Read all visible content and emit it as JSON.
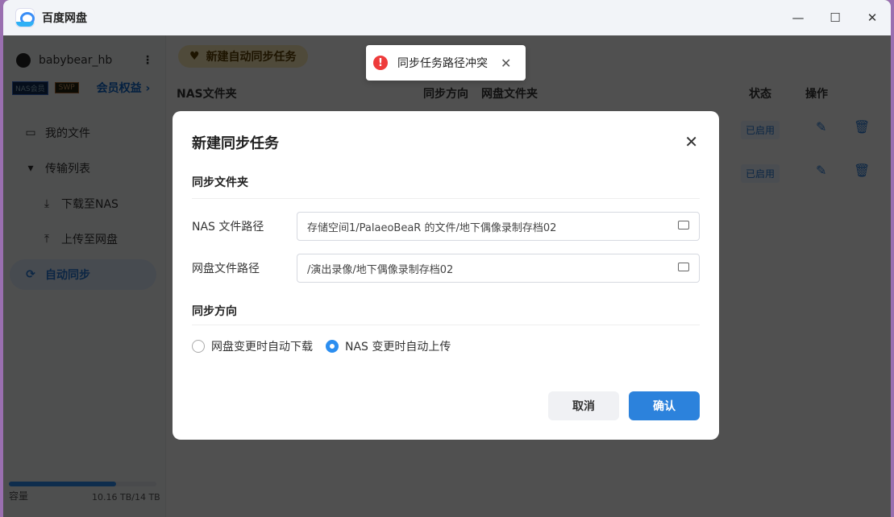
{
  "app": {
    "title": "百度网盘"
  },
  "sidebar": {
    "username": "babybear_hb",
    "badges": [
      "NAS会员",
      "SWP"
    ],
    "vip_link": "会员权益 ›",
    "items": [
      {
        "label": "我的文件",
        "icon": "folder-icon"
      },
      {
        "label": "传输列表",
        "icon": "caret-down-icon"
      },
      {
        "label": "下载至NAS",
        "icon": "download-icon"
      },
      {
        "label": "上传至网盘",
        "icon": "upload-icon"
      },
      {
        "label": "自动同步",
        "icon": "sync-icon",
        "active": true
      }
    ],
    "storage": {
      "label": "容量",
      "value": "10.16 TB/14 TB",
      "used_fraction": 0.726
    }
  },
  "main": {
    "new_button": "新建自动同步任务",
    "columns": [
      "NAS文件夹",
      "同步方向",
      "网盘文件夹",
      "状态",
      "操作"
    ],
    "rows": [
      {
        "status": "已启用"
      },
      {
        "status": "已启用"
      }
    ]
  },
  "toast": {
    "message": "同步任务路径冲突"
  },
  "modal": {
    "title": "新建同步任务",
    "section_folder": "同步文件夹",
    "nas_label": "NAS 文件路径",
    "nas_value": "存储空间1/PalaeoBeaR 的文件/地下偶像录制存档02",
    "cloud_label": "网盘文件路径",
    "cloud_value": "/演出录像/地下偶像录制存档02",
    "section_direction": "同步方向",
    "options": [
      "网盘变更时自动下载",
      "NAS 变更时自动上传"
    ],
    "selected_option": 1,
    "cancel": "取消",
    "confirm": "确认"
  },
  "colors": {
    "accent": "#2c8ef0",
    "error": "#ee3b3b"
  }
}
